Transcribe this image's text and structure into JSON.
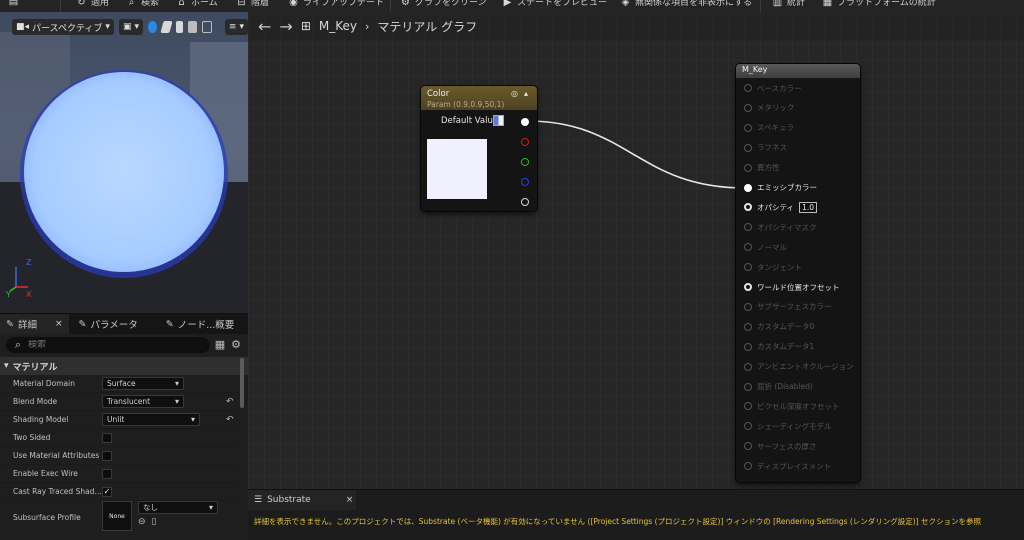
{
  "toolbar": {
    "items": [
      {
        "label": "",
        "icon": "save-icon"
      },
      {
        "label": "適用",
        "icon": "apply-icon"
      },
      {
        "label": "検索",
        "icon": "search-icon"
      },
      {
        "label": "ホーム",
        "icon": "home-icon"
      },
      {
        "label": "階層",
        "icon": "hierarchy-icon"
      },
      {
        "label": "ライブアップデート",
        "icon": "live-update-icon"
      },
      {
        "label": "グラフをクリーン",
        "icon": "clean-graph-icon"
      },
      {
        "label": "ステートをプレビュー",
        "icon": "preview-state-icon"
      },
      {
        "label": "無関係な項目を非表示にする",
        "icon": "hide-unrelated-icon"
      },
      {
        "label": "統計",
        "icon": "stats-icon"
      },
      {
        "label": "プラットフォームの統計",
        "icon": "platform-stats-icon"
      }
    ]
  },
  "viewport": {
    "view_mode": "パースペクティブ",
    "axis": {
      "z": "Z",
      "y": "Y",
      "x": "X"
    }
  },
  "details": {
    "tabs": [
      {
        "label": "詳細",
        "icon": "details-icon",
        "close": "×"
      },
      {
        "label": "パラメータ",
        "icon": "parameters-icon"
      },
      {
        "label": "ノード...概要",
        "icon": "node-palette-icon"
      }
    ],
    "search_placeholder": "検索",
    "category": "マテリアル",
    "properties": [
      {
        "label": "Material Domain",
        "kind": "combo",
        "value": "Surface"
      },
      {
        "label": "Blend Mode",
        "kind": "combo",
        "value": "Translucent",
        "reset": true
      },
      {
        "label": "Shading Model",
        "kind": "combo",
        "value": "Unlit",
        "reset": true
      },
      {
        "label": "Two Sided",
        "kind": "check",
        "checked": false
      },
      {
        "label": "Use Material Attributes",
        "kind": "check",
        "checked": false
      },
      {
        "label": "Enable Exec Wire",
        "kind": "check",
        "checked": false
      },
      {
        "label": "Cast Ray Traced Shad...",
        "kind": "check",
        "checked": true
      }
    ],
    "subsurface": {
      "label": "Subsurface Profile",
      "thumb_text": "None",
      "combo_value": "なし"
    }
  },
  "graph": {
    "breadcrumb_asset": "M_Key",
    "breadcrumb_view": "マテリアル グラフ",
    "color_node": {
      "title": "Color",
      "subtitle": "Param (0.9,0.9,50,1)",
      "default_label": "Default Value",
      "swatch_color": "#f0f0ff",
      "out_pins": [
        "#ffffff",
        "#d02020",
        "#20c020",
        "#2040e0",
        "#d8d8d8"
      ]
    },
    "mkey_node": {
      "title": "M_Key",
      "inputs": [
        {
          "label": "ベースカラー",
          "state": "dim"
        },
        {
          "label": "メタリック",
          "state": "dim"
        },
        {
          "label": "スペキュラ",
          "state": "dim"
        },
        {
          "label": "ラフネス",
          "state": "dim"
        },
        {
          "label": "異方性",
          "state": "dim"
        },
        {
          "label": "エミッシブカラー",
          "state": "connected"
        },
        {
          "label": "オパシティ",
          "state": "lit",
          "value": "1.0"
        },
        {
          "label": "オパシティマスク",
          "state": "dim"
        },
        {
          "label": "ノーマル",
          "state": "dim"
        },
        {
          "label": "タンジェント",
          "state": "dim"
        },
        {
          "label": "ワールド位置オフセット",
          "state": "lit"
        },
        {
          "label": "サブサーフェスカラー",
          "state": "dim"
        },
        {
          "label": "カスタムデータ0",
          "state": "dim"
        },
        {
          "label": "カスタムデータ1",
          "state": "dim"
        },
        {
          "label": "アンビエントオクルージョン",
          "state": "dim"
        },
        {
          "label": "屈折 (Disabled)",
          "state": "dim"
        },
        {
          "label": "ピクセル深度オフセット",
          "state": "dim"
        },
        {
          "label": "シェーディングモデル",
          "state": "dim"
        },
        {
          "label": "サーフェスの厚さ",
          "state": "dim"
        },
        {
          "label": "ディスプレイスメント",
          "state": "dim"
        }
      ]
    }
  },
  "message_panel": {
    "tab_label": "Substrate",
    "tab_close": "×",
    "text": "詳細を表示できません。このプロジェクトでは、Substrate (ベータ機能) が有効になっていません ([Project Settings (プロジェクト設定)] ウィンドウの [Rendering Settings (レンダリング設定)] セクションを参照"
  }
}
